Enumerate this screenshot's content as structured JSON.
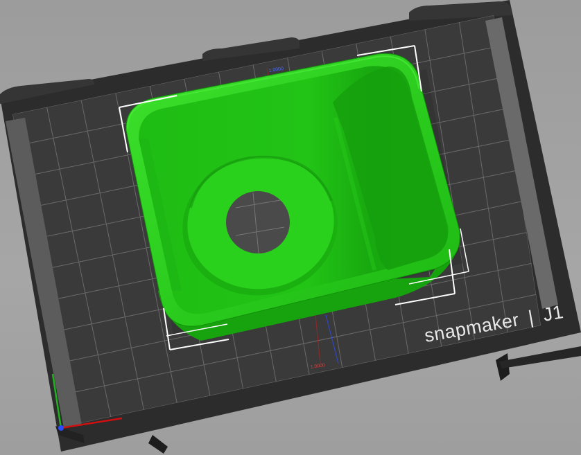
{
  "viewport": {
    "name": "3D slicer build plate view"
  },
  "bed": {
    "brand": "snapmaker",
    "model": "J1",
    "separator": "|",
    "colors": {
      "frame": "#2f2f2f",
      "surface": "#3a3a3a",
      "grid": "#6a6a6a",
      "edge_strip": "#5e5e5e"
    }
  },
  "model": {
    "description": "green rectangular cup/bin with round opening",
    "selected": true,
    "colors": {
      "body": "#22c416",
      "rim": "#2ed61f",
      "shade": "#14a10c",
      "inner_wall": "#1aa811"
    }
  },
  "axes": {
    "x_color": "#d01010",
    "y_color": "#22b020",
    "z_color": "#2a4cff"
  },
  "background": "#a0a0a0"
}
